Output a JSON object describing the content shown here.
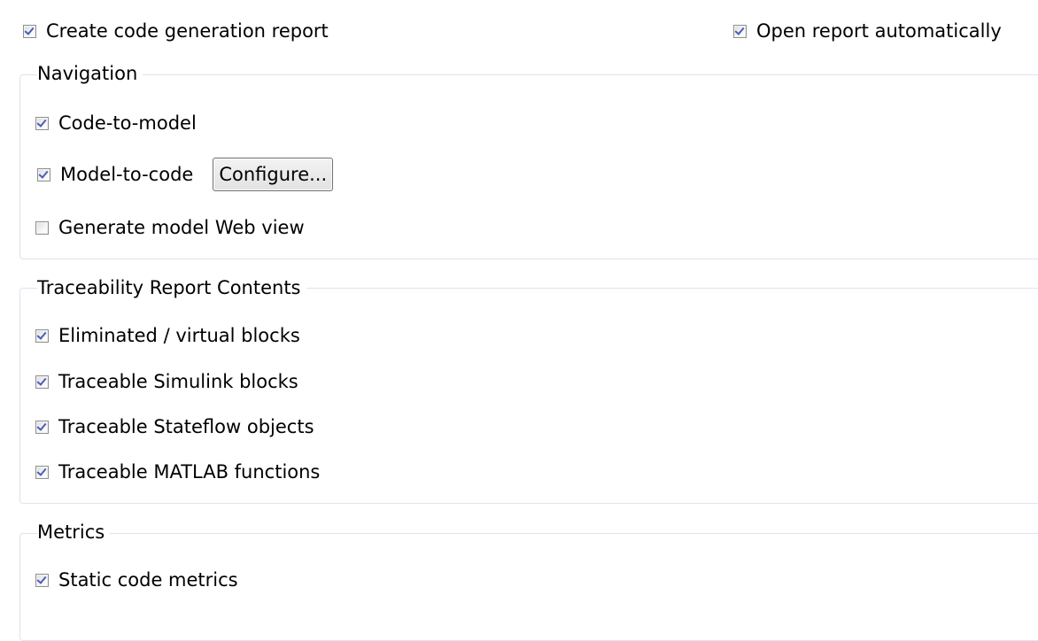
{
  "top": {
    "create_report": {
      "label": "Create code generation report",
      "checked": true
    },
    "open_auto": {
      "label": "Open report automatically",
      "checked": true
    }
  },
  "navigation": {
    "title": "Navigation",
    "code_to_model": {
      "label": "Code-to-model",
      "checked": true
    },
    "model_to_code": {
      "label": "Model-to-code",
      "checked": true
    },
    "configure_label": "Configure...",
    "web_view": {
      "label": "Generate model Web view",
      "checked": false
    }
  },
  "traceability": {
    "title": "Traceability Report Contents",
    "items": [
      {
        "label": "Eliminated / virtual blocks",
        "checked": true
      },
      {
        "label": "Traceable Simulink blocks",
        "checked": true
      },
      {
        "label": "Traceable Stateflow objects",
        "checked": true
      },
      {
        "label": "Traceable MATLAB functions",
        "checked": true
      }
    ]
  },
  "metrics": {
    "title": "Metrics",
    "static_code": {
      "label": "Static code metrics",
      "checked": true
    }
  }
}
